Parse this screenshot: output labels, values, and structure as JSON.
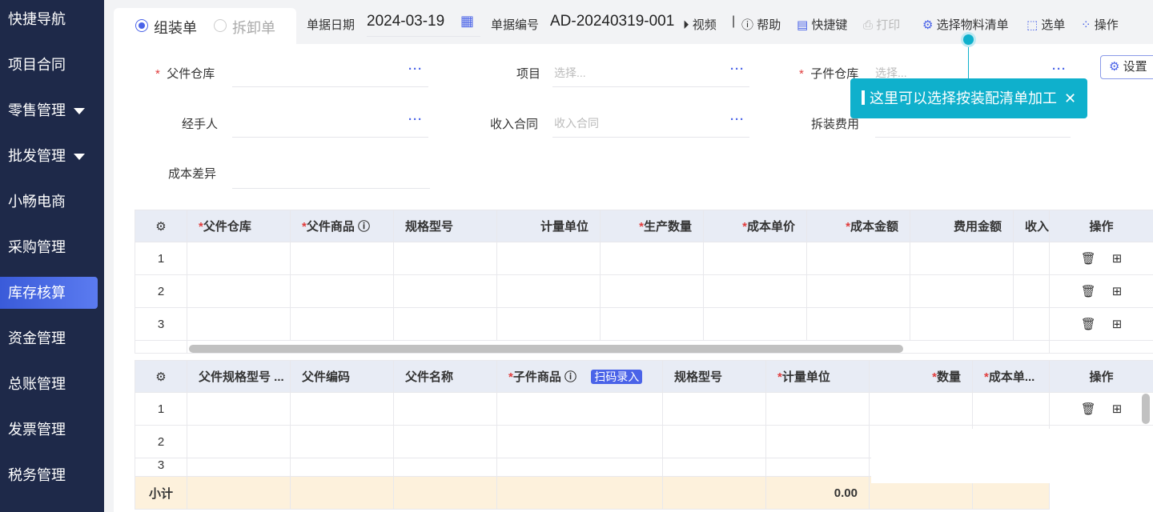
{
  "sidebar": {
    "items": [
      {
        "label": "快捷导航",
        "caret": false
      },
      {
        "label": "项目合同",
        "caret": false
      },
      {
        "label": "零售管理",
        "caret": true
      },
      {
        "label": "批发管理",
        "caret": true
      },
      {
        "label": "小畅电商",
        "caret": false
      },
      {
        "label": "采购管理",
        "caret": false
      },
      {
        "label": "库存核算",
        "caret": false,
        "active": true
      },
      {
        "label": "资金管理",
        "caret": false
      },
      {
        "label": "总账管理",
        "caret": false
      },
      {
        "label": "发票管理",
        "caret": false
      },
      {
        "label": "税务管理",
        "caret": false
      }
    ]
  },
  "header": {
    "mode_assemble": "组装单",
    "mode_disassemble": "拆卸单",
    "date_label": "单据日期",
    "date_value": "2024-03-19",
    "no_label": "单据编号",
    "no_value": "AD-20240319-001",
    "tools": {
      "video": "视频",
      "help": "帮助",
      "shortcut": "快捷键",
      "print": "打印",
      "bom": "选择物料清单",
      "pick": "选单",
      "ops": "操作"
    }
  },
  "tooltip": {
    "text": "这里可以选择按装配清单加工",
    "close": "✕"
  },
  "settings_label": "设置",
  "form": {
    "parent_wh": "父件仓库",
    "project": "项目",
    "project_ph": "选择...",
    "child_wh": "子件仓库",
    "child_wh_ph": "选择...",
    "handler": "经手人",
    "contract": "收入合同",
    "contract_ph": "收入合同",
    "fee": "拆装费用",
    "cost_diff": "成本差异",
    "more": "···"
  },
  "table1": {
    "headers": [
      "父件仓库",
      "父件商品",
      "规格型号",
      "计量单位",
      "生产数量",
      "成本单价",
      "成本金额",
      "费用金额",
      "收入"
    ],
    "required": [
      true,
      true,
      false,
      false,
      true,
      true,
      true,
      false,
      false
    ],
    "ops": "操作",
    "rows": [
      "1",
      "2",
      "3"
    ]
  },
  "table2": {
    "headers": [
      "父件规格型号 ...",
      "父件编码",
      "父件名称",
      "子件商品",
      "规格型号",
      "计量单位",
      "数量",
      "成本单..."
    ],
    "required": [
      false,
      false,
      false,
      true,
      false,
      true,
      true,
      true
    ],
    "scan": "扫码录入",
    "ops": "操作",
    "rows": [
      "1",
      "2",
      "3"
    ],
    "subtotal_label": "小计",
    "subtotal_qty": "0.00"
  }
}
